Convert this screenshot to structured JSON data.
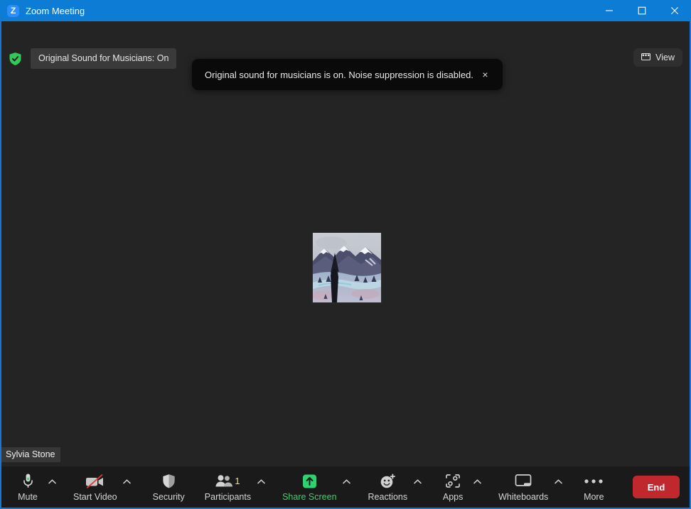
{
  "window": {
    "title": "Zoom Meeting",
    "logo_letter": "Z",
    "controls": {
      "minimize": "minimize-button",
      "maximize": "maximize-button",
      "close": "close-button"
    }
  },
  "stage": {
    "original_sound": {
      "icon": "shield-check-icon",
      "label": "Original Sound for Musicians: On"
    },
    "view_button": {
      "icon": "layout-grid-icon",
      "label": "View"
    },
    "toast": {
      "message": "Original sound for musicians is on. Noise suppression is disabled.",
      "close_icon": "close-icon",
      "close_label": "×"
    },
    "participant": {
      "name": "Sylvia Stone",
      "avatar": "mountain-landscape-avatar"
    }
  },
  "toolbar": {
    "items": [
      {
        "name": "mute",
        "label": "Mute",
        "icon": "microphone-icon",
        "caret": true
      },
      {
        "name": "start-video",
        "label": "Start Video",
        "icon": "video-off-icon",
        "caret": true
      },
      {
        "name": "security",
        "label": "Security",
        "icon": "shield-icon",
        "caret": false
      },
      {
        "name": "participants",
        "label": "Participants",
        "icon": "people-icon",
        "count": "1",
        "caret": true
      },
      {
        "name": "share-screen",
        "label": "Share Screen",
        "icon": "share-arrow-icon",
        "caret": true,
        "highlight": true
      },
      {
        "name": "reactions",
        "label": "Reactions",
        "icon": "smiley-plus-icon",
        "caret": true
      },
      {
        "name": "apps",
        "label": "Apps",
        "icon": "apps-bracket-icon",
        "caret": true
      },
      {
        "name": "whiteboards",
        "label": "Whiteboards",
        "icon": "whiteboard-monitor-icon",
        "caret": true
      },
      {
        "name": "more",
        "label": "More",
        "icon": "ellipsis-icon",
        "caret": false
      }
    ],
    "end_button": "End"
  },
  "colors": {
    "titlebar": "#0c7cd5",
    "stage_bg": "#242424",
    "toolbar_bg": "#1a1a1a",
    "accent_green": "#2dd36f",
    "share_text_green": "#3fcf6a",
    "end_red": "#c0282d",
    "shield_green": "#34c759",
    "count_text": "#e6d9a8",
    "window_border": "#1976d2"
  }
}
